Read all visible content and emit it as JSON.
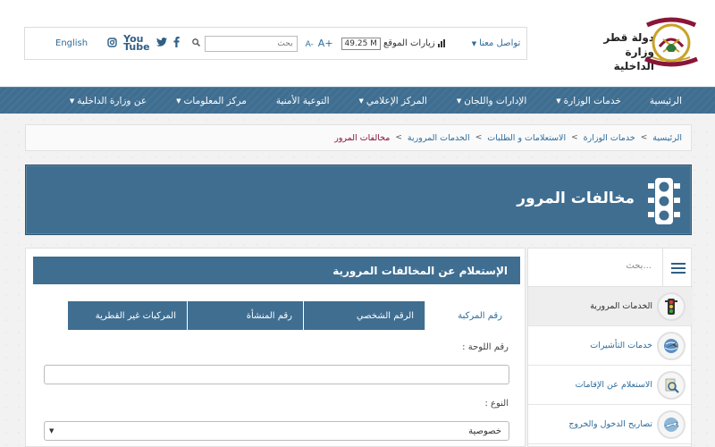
{
  "header": {
    "logo_line1": "دولة قطر",
    "logo_line2": "وزارة الداخلية",
    "language_link": "English",
    "search_placeholder": "بحث",
    "font_increase": "A+",
    "font_decrease": "A-",
    "visits_label": "زيارات الموقع",
    "visits_count": "49.25 M",
    "contact_label": "تواصل معنا",
    "social_icons": [
      "instagram-icon",
      "youtube-icon",
      "twitter-icon",
      "facebook-icon"
    ],
    "youtube_text": [
      "You",
      "Tube"
    ]
  },
  "nav": {
    "items": [
      {
        "label": "الرئيسية",
        "has_dropdown": false
      },
      {
        "label": "خدمات الوزارة",
        "has_dropdown": true
      },
      {
        "label": "الإدارات واللجان",
        "has_dropdown": true
      },
      {
        "label": "المركز الإعلامي",
        "has_dropdown": true
      },
      {
        "label": "التوعية الأمنية",
        "has_dropdown": false
      },
      {
        "label": "مركز المعلومات",
        "has_dropdown": true
      },
      {
        "label": "عن وزارة الداخلية",
        "has_dropdown": true
      }
    ]
  },
  "breadcrumb": {
    "items": [
      "الرئيسية",
      "خدمات الوزارة",
      "الاستعلامات و الطلبات",
      "الخدمات المرورية",
      "مخالفات المرور"
    ],
    "separator": ">"
  },
  "banner": {
    "title": "مخالفات المرور",
    "icon": "traffic-light-icon"
  },
  "main": {
    "panel_title": "الإستعلام عن المخالفات المرورية",
    "tabs": [
      {
        "label": "رقم المركبة",
        "active": true
      },
      {
        "label": "الرقم الشخصي",
        "active": false
      },
      {
        "label": "رقم المنشأة",
        "active": false
      },
      {
        "label": "المركبات غير القطرية",
        "active": false
      }
    ],
    "plate_label": "رقم اللوحة :",
    "plate_value": "",
    "type_label": "النوع :",
    "type_value": "خصوصية"
  },
  "sidebar": {
    "search_placeholder": "بحث...",
    "items": [
      {
        "label": "الخدمات المرورية",
        "icon": "traffic-light-icon",
        "active": true
      },
      {
        "label": "خدمات التأشيرات",
        "icon": "airplane-globe-icon",
        "active": false
      },
      {
        "label": "الاستعلام عن الإقامات",
        "icon": "magnifier-document-icon",
        "active": false
      },
      {
        "label": "تصاريح الدخول والخروج",
        "icon": "airplane-icon",
        "active": false
      }
    ]
  },
  "colors": {
    "primary": "#3f6e91",
    "link": "#2e6d9c",
    "maroon": "#8a1538",
    "gold": "#c9a227"
  }
}
